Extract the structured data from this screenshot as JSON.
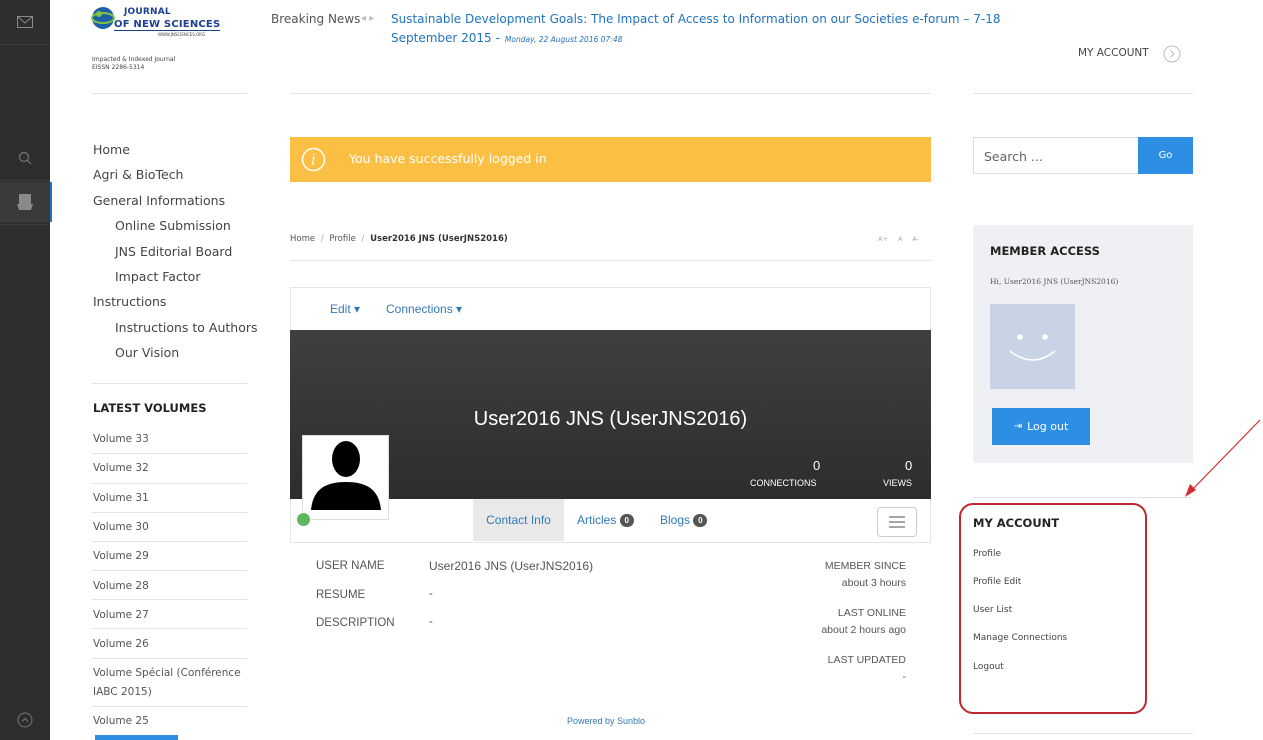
{
  "logo": {
    "line1": "JOURNAL",
    "line2": "OF NEW SCIENCES",
    "url_small": "WWW.JNSCIENCES.ORG",
    "tag1": "Impacted & Indexed Journal",
    "tag2": "EISSN 2286-5314"
  },
  "breaking": {
    "label": "Breaking News",
    "headline_line1": "Sustainable Development Goals: The Impact of Access to Information on our Societies e-forum – 7-18",
    "headline_line2": "September 2015 -",
    "date": "Monday, 22 August 2016 07:48"
  },
  "header": {
    "my_account": "MY ACCOUNT"
  },
  "nav": {
    "items": [
      "Home",
      "Agri & BioTech",
      "General Informations",
      "Online Submission",
      "JNS Editorial Board",
      "Impact Factor",
      "Instructions",
      "Instructions to Authors",
      "Our Vision"
    ]
  },
  "volumes": {
    "heading": "LATEST VOLUMES",
    "items": [
      "Volume 33",
      "Volume 32",
      "Volume 31",
      "Volume 30",
      "Volume 29",
      "Volume 28",
      "Volume 27",
      "Volume 26",
      "Volume Spécial (Conférence",
      "IABC 2015)",
      "Volume 25"
    ]
  },
  "alert": {
    "text": "You have successfully logged in"
  },
  "breadcrumb": {
    "home": "Home",
    "sep": "/",
    "profile": "Profile",
    "current": "User2016 JNS (UserJNS2016)",
    "font_tools": [
      "A+",
      "A",
      "A-"
    ]
  },
  "profile": {
    "menu_edit": "Edit ▾",
    "menu_connections": "Connections ▾",
    "name": "User2016 JNS (UserJNS2016)",
    "connections_value": "0",
    "connections_label": "CONNECTIONS",
    "views_value": "0",
    "views_label": "VIEWS",
    "tabs": [
      {
        "label": "Contact Info"
      },
      {
        "label": "Articles",
        "count": "0"
      },
      {
        "label": "Blogs",
        "count": "0"
      }
    ],
    "fields": [
      {
        "label": "USER NAME",
        "value": "User2016 JNS (UserJNS2016)"
      },
      {
        "label": "RESUME",
        "value": "-"
      },
      {
        "label": "DESCRIPTION",
        "value": "-"
      }
    ],
    "member_since_label": "MEMBER SINCE",
    "member_since_value": "about 3 hours",
    "last_online_label": "LAST ONLINE",
    "last_online_value": "about 2 hours ago",
    "last_updated_label": "LAST UPDATED",
    "last_updated_value": "-",
    "powered_by": "Powered by Sunblo",
    "online_status_color": "#5cb85c"
  },
  "sidebar": {
    "search_placeholder": "Search ...",
    "go_label": "Go",
    "member_access_heading": "MEMBER ACCESS",
    "greeting": "Hi, User2016 JNS (UserJNS2016)",
    "logout_label": "Log out",
    "my_account_heading": "MY ACCOUNT",
    "account_links": [
      "Profile",
      "Profile Edit",
      "User List",
      "Manage Connections",
      "Logout"
    ]
  },
  "colors": {
    "accent": "#2d8fe3",
    "alert": "#fbc043",
    "link": "#1e73be",
    "annotation": "#c0282f"
  },
  "icons": [
    "mail-icon",
    "search-icon",
    "user-card-icon",
    "scroll-top-icon",
    "info-icon",
    "chevron-right-icon",
    "list-menu-icon",
    "sign-out-icon"
  ]
}
